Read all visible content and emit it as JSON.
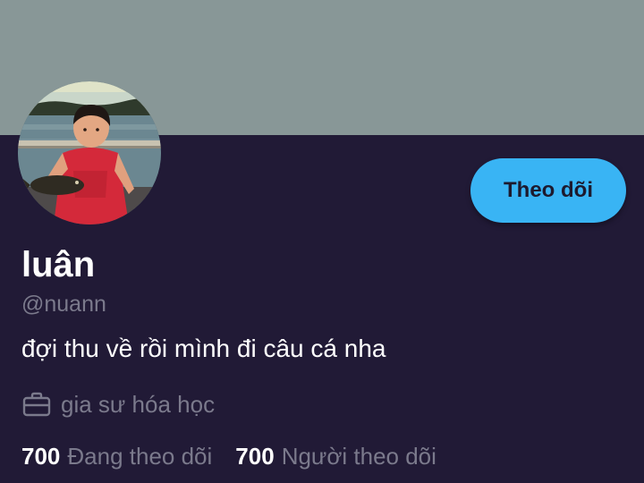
{
  "profile": {
    "display_name": "luân",
    "handle": "@nuann",
    "bio": "đợi thu về rồi mình đi câu cá nha",
    "job": {
      "icon": "briefcase-icon",
      "label": "gia sư hóa học"
    },
    "follow_button_label": "Theo dõi",
    "stats": {
      "following_count": "700",
      "following_label": "Đang theo dõi",
      "followers_count": "700",
      "followers_label": "Người theo dõi"
    }
  },
  "colors": {
    "banner": "#889797",
    "background": "#211a36",
    "accent": "#39b4f4",
    "muted_text": "#7b7a8c",
    "primary_text": "#ffffff"
  }
}
